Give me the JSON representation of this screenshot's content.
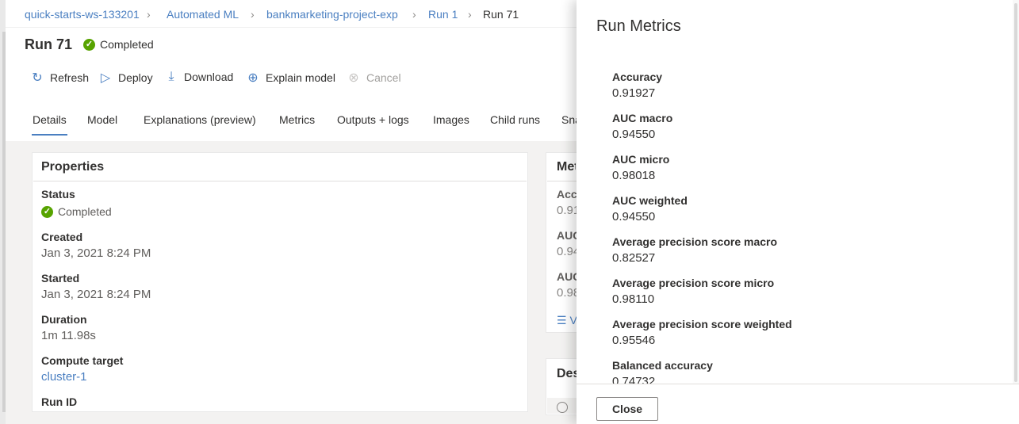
{
  "breadcrumb": {
    "items": [
      "quick-starts-ws-133201",
      "Automated ML",
      "bankmarketing-project-exp",
      "Run 1"
    ],
    "current": "Run 71"
  },
  "run": {
    "title": "Run 71",
    "status": "Completed"
  },
  "toolbar": {
    "refresh": "Refresh",
    "deploy": "Deploy",
    "download": "Download",
    "explain_model": "Explain model",
    "cancel": "Cancel"
  },
  "tabs": [
    "Details",
    "Model",
    "Explanations (preview)",
    "Metrics",
    "Outputs + logs",
    "Images",
    "Child runs",
    "Sna"
  ],
  "properties": {
    "title": "Properties",
    "status_label": "Status",
    "status_value": "Completed",
    "created_label": "Created",
    "created_value": "Jan 3, 2021 8:24 PM",
    "started_label": "Started",
    "started_value": "Jan 3, 2021 8:24 PM",
    "duration_label": "Duration",
    "duration_value": "1m 11.98s",
    "compute_label": "Compute target",
    "compute_value": "cluster-1",
    "runid_label": "Run ID"
  },
  "metrics_card": {
    "title": "Met",
    "items": [
      {
        "label": "Accu",
        "value": "0.91"
      },
      {
        "label": "AUC",
        "value": "0.94"
      },
      {
        "label": "AUC",
        "value": "0.98"
      }
    ],
    "view_link": "V"
  },
  "description_card": {
    "title": "Des"
  },
  "panel": {
    "title": "Run Metrics",
    "metrics": [
      {
        "label": "Accuracy",
        "value": "0.91927"
      },
      {
        "label": "AUC macro",
        "value": "0.94550"
      },
      {
        "label": "AUC micro",
        "value": "0.98018"
      },
      {
        "label": "AUC weighted",
        "value": "0.94550"
      },
      {
        "label": "Average precision score macro",
        "value": "0.82527"
      },
      {
        "label": "Average precision score micro",
        "value": "0.98110"
      },
      {
        "label": "Average precision score weighted",
        "value": "0.95546"
      },
      {
        "label": "Balanced accuracy",
        "value": "0.74732"
      }
    ],
    "close_label": "Close"
  },
  "colors": {
    "accent": "#4a7fc1",
    "success": "#57a300"
  }
}
